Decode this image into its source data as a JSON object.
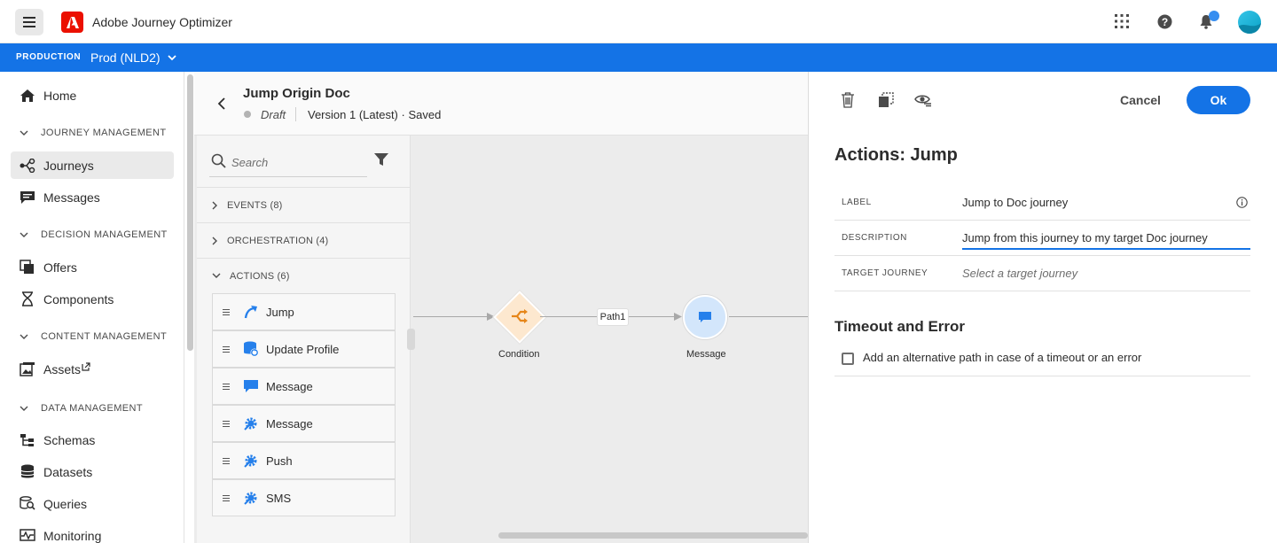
{
  "app": {
    "title": "Adobe Journey Optimizer"
  },
  "environment": {
    "label": "PRODUCTION",
    "sandbox": "Prod (NLD2)"
  },
  "nav": {
    "home": "Home",
    "sections": [
      {
        "title": "JOURNEY MANAGEMENT",
        "items": [
          "Journeys",
          "Messages"
        ]
      },
      {
        "title": "DECISION MANAGEMENT",
        "items": [
          "Offers",
          "Components"
        ]
      },
      {
        "title": "CONTENT MANAGEMENT",
        "items": [
          "Assets"
        ]
      },
      {
        "title": "DATA MANAGEMENT",
        "items": [
          "Schemas",
          "Datasets",
          "Queries",
          "Monitoring"
        ]
      }
    ],
    "active": "Journeys"
  },
  "journey": {
    "title": "Jump Origin Doc",
    "status": "Draft",
    "version": "Version 1 (Latest) · Saved"
  },
  "palette": {
    "search_placeholder": "Search",
    "categories": [
      "EVENTS (8)",
      "ORCHESTRATION (4)",
      "ACTIONS (6)"
    ],
    "actions": [
      "Jump",
      "Update Profile",
      "Message",
      "Message",
      "Push",
      "SMS"
    ]
  },
  "canvas": {
    "condition_label": "Condition",
    "path_label": "Path1",
    "message_label": "Message"
  },
  "panel": {
    "cancel_label": "Cancel",
    "ok_label": "Ok",
    "title": "Actions: Jump",
    "fields": {
      "label_key": "LABEL",
      "label_value": "Jump to Doc journey",
      "description_key": "DESCRIPTION",
      "description_value": "Jump from this journey to my target Doc journey",
      "target_key": "TARGET JOURNEY",
      "target_placeholder": "Select a target journey"
    },
    "timeout_title": "Timeout and Error",
    "timeout_checkbox_label": "Add an alternative path in case of a timeout or an error",
    "timeout_checked": false
  },
  "colors": {
    "brand_blue": "#1473e6",
    "adobe_red": "#eb1000",
    "condition_orange": "#e68619",
    "message_blue": "#2680eb"
  }
}
